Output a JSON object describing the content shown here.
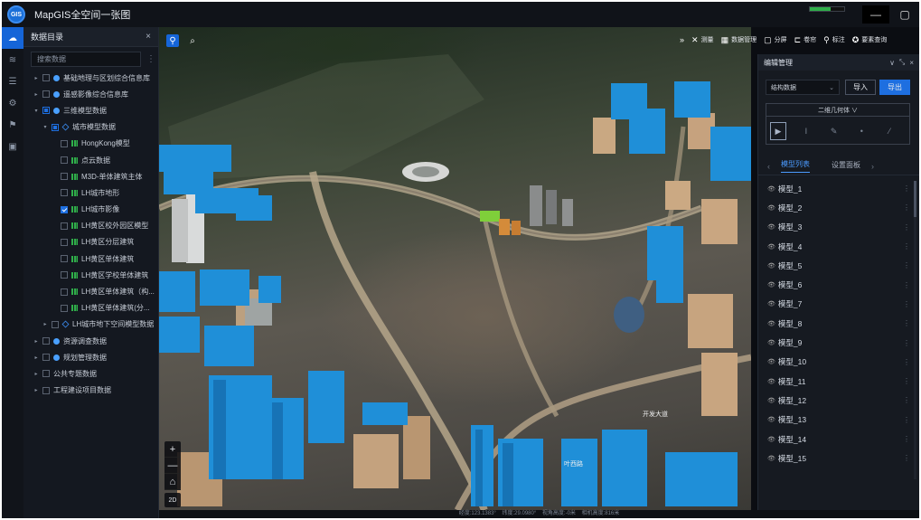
{
  "app": {
    "title": "MapGIS全空间一张图",
    "win_min": "—",
    "win_max": "▢"
  },
  "rail": [
    "data-catalog-icon",
    "layers-icon",
    "list-icon",
    "settings-icon",
    "tools-icon",
    "monitor-icon"
  ],
  "catalog": {
    "title": "数据目录",
    "close": "×",
    "search_placeholder": "搜索数据",
    "items": [
      {
        "indent": 0,
        "twist": "▸",
        "check": "none",
        "icon": "dot",
        "label": "基础地理与区划综合信息库"
      },
      {
        "indent": 0,
        "twist": "▸",
        "check": "none",
        "icon": "dot",
        "label": "遥感影像综合信息库"
      },
      {
        "indent": 0,
        "twist": "▾",
        "check": "partial",
        "icon": "dot",
        "label": "三维模型数据"
      },
      {
        "indent": 1,
        "twist": "▾",
        "check": "partial",
        "icon": "layer",
        "label": "城市模型数据"
      },
      {
        "indent": 2,
        "twist": "",
        "check": "none",
        "icon": "bar",
        "label": "HongKong模型"
      },
      {
        "indent": 2,
        "twist": "",
        "check": "none",
        "icon": "bar",
        "label": "点云数据"
      },
      {
        "indent": 2,
        "twist": "",
        "check": "none",
        "icon": "bar",
        "label": "M3D-单体建筑主体"
      },
      {
        "indent": 2,
        "twist": "",
        "check": "none",
        "icon": "bar",
        "label": "LH城市地形"
      },
      {
        "indent": 2,
        "twist": "",
        "check": "checked",
        "icon": "bar",
        "label": "LH城市影像"
      },
      {
        "indent": 2,
        "twist": "",
        "check": "none",
        "icon": "bar",
        "label": "LH黄区校外园区模型"
      },
      {
        "indent": 2,
        "twist": "",
        "check": "none",
        "icon": "bar",
        "label": "LH黄区分层建筑"
      },
      {
        "indent": 2,
        "twist": "",
        "check": "none",
        "icon": "bar",
        "label": "LH黄区单体建筑"
      },
      {
        "indent": 2,
        "twist": "",
        "check": "none",
        "icon": "bar",
        "label": "LH黄区学校单体建筑"
      },
      {
        "indent": 2,
        "twist": "",
        "check": "none",
        "icon": "bar",
        "label": "LH黄区单体建筑（构..."
      },
      {
        "indent": 2,
        "twist": "",
        "check": "none",
        "icon": "bar",
        "label": "LH黄区单体建筑(分..."
      },
      {
        "indent": 1,
        "twist": "▸",
        "check": "none",
        "icon": "layer",
        "label": "LH城市地下空间模型数据"
      },
      {
        "indent": 0,
        "twist": "▸",
        "check": "none",
        "icon": "dot",
        "label": "资源调查数据"
      },
      {
        "indent": 0,
        "twist": "▸",
        "check": "none",
        "icon": "dot",
        "label": "规划管理数据"
      },
      {
        "indent": 0,
        "twist": "▸",
        "check": "none",
        "icon": "none",
        "label": "公共专题数据"
      },
      {
        "indent": 0,
        "twist": "▸",
        "check": "none",
        "icon": "none",
        "label": "工程建设项目数据"
      }
    ]
  },
  "toolbar": {
    "expand": "»",
    "items": [
      {
        "icon": "measure-icon",
        "glyph": "✕",
        "label": "测量"
      },
      {
        "icon": "grid-icon",
        "glyph": "▦",
        "label": "数据管理"
      },
      {
        "icon": "split-icon",
        "glyph": "▢",
        "label": "分屏"
      },
      {
        "icon": "switch-icon",
        "glyph": "⊏",
        "label": "卷帘"
      },
      {
        "icon": "mark-icon",
        "glyph": "⚲",
        "label": "标注"
      },
      {
        "icon": "query-icon",
        "glyph": "✪",
        "label": "要素查询"
      }
    ]
  },
  "edit_panel": {
    "title": "编辑管理",
    "controls": [
      "∨",
      "⤡",
      "×"
    ],
    "data_select": "结构数据",
    "import_label": "导入",
    "export_label": "导出",
    "geometry_type": "二维几何体 ∨",
    "tabs": [
      "模型列表",
      "设置面板"
    ],
    "models": [
      "模型_1",
      "模型_2",
      "模型_3",
      "模型_4",
      "模型_5",
      "模型_6",
      "模型_7",
      "模型_8",
      "模型_9",
      "模型_10",
      "模型_11",
      "模型_12",
      "模型_13",
      "模型_14",
      "模型_15"
    ]
  },
  "status": "经度:123.1383°    纬度:29.0980°    视角高度:-0米    相机高度:816米",
  "colors": {
    "accent": "#1e6fe0",
    "building": "#1f8fd8",
    "tan_building": "#c4a27e"
  }
}
